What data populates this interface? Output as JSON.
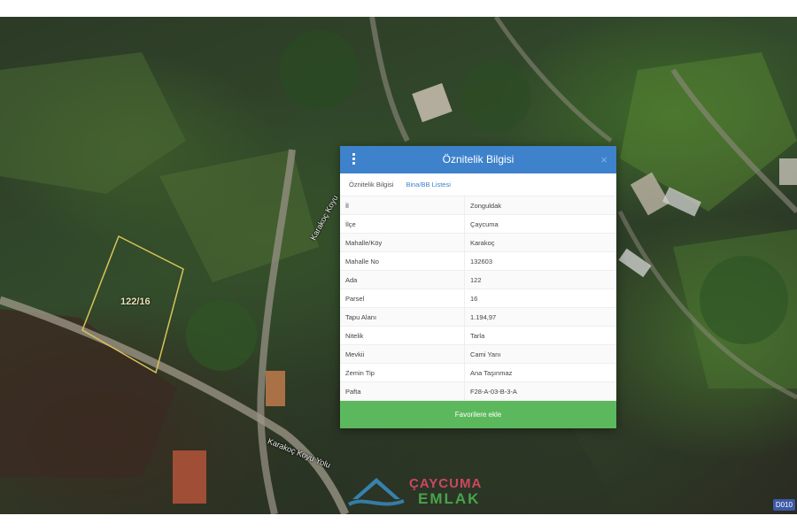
{
  "dialog": {
    "title": "Öznitelik Bilgisi",
    "close_label": "×",
    "tabs": [
      {
        "label": "Öznitelik Bilgisi"
      },
      {
        "label": "Bina/BB Listesi"
      }
    ],
    "rows": [
      {
        "key": "İl",
        "value": "Zonguldak"
      },
      {
        "key": "İlçe",
        "value": "Çaycuma"
      },
      {
        "key": "Mahalle/Köy",
        "value": "Karakoç"
      },
      {
        "key": "Mahalle No",
        "value": "132603"
      },
      {
        "key": "Ada",
        "value": "122"
      },
      {
        "key": "Parsel",
        "value": "16"
      },
      {
        "key": "Tapu Alanı",
        "value": "1.194,97"
      },
      {
        "key": "Nitelik",
        "value": "Tarla"
      },
      {
        "key": "Mevkii",
        "value": "Cami Yanı"
      },
      {
        "key": "Zemin Tip",
        "value": "Ana Taşınmaz"
      },
      {
        "key": "Pafta",
        "value": "F28-A-03-B-3-A"
      }
    ],
    "favorite_button": "Favorilere ekle"
  },
  "map": {
    "parcel_label": "122/16",
    "road_label_1": "Karakoç Koyu",
    "road_label_2": "Karakoç Koyu Yolu",
    "corner_badge": "D010",
    "parcel_outline_color": "#d8c35a"
  },
  "watermark": {
    "line1": "ÇAYCUMA",
    "line2": "EMLAK"
  },
  "colors": {
    "header": "#3e82cc",
    "button": "#5cb85c",
    "link": "#3e82cc"
  }
}
